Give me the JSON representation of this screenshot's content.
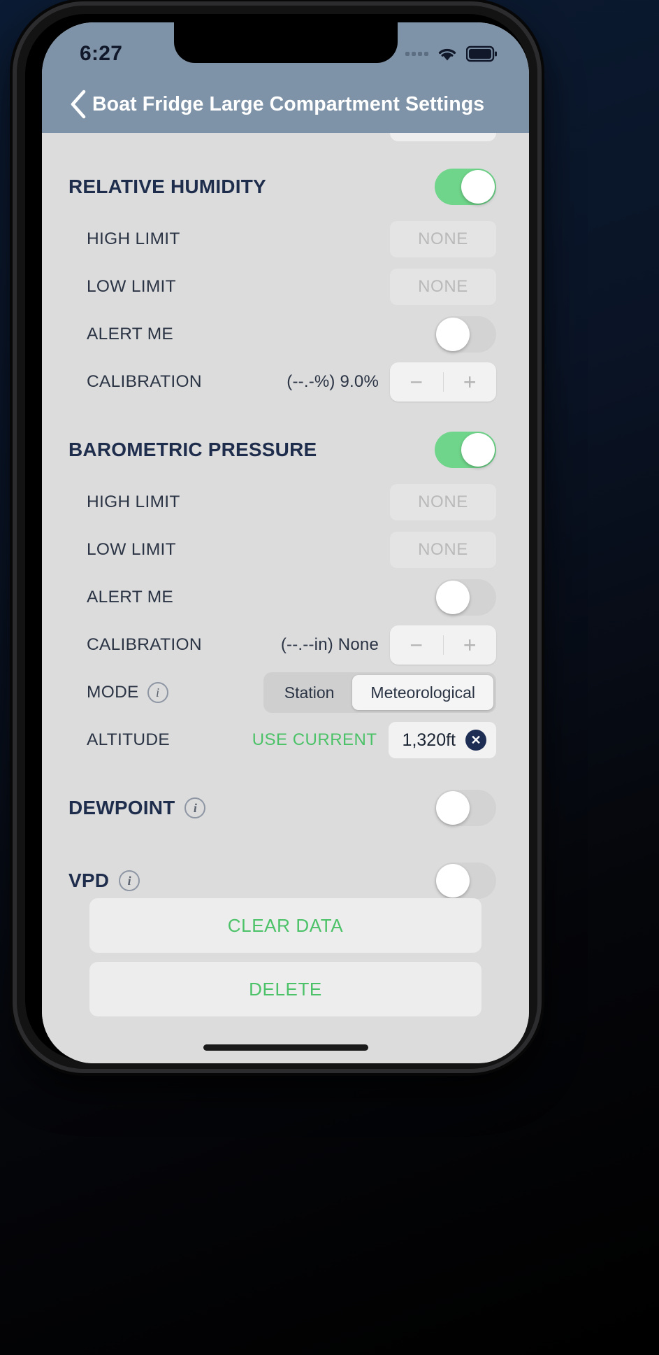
{
  "status_bar": {
    "time": "6:27",
    "signal_icon": "signal-dots-icon",
    "wifi_icon": "wifi-icon",
    "battery_icon": "battery-full-icon"
  },
  "nav": {
    "back_icon": "chevron-left-icon",
    "title": "Boat Fridge Large Compartment Settings"
  },
  "sections": {
    "relative_humidity": {
      "title": "RELATIVE HUMIDITY",
      "enabled": true,
      "rows": {
        "high_limit": {
          "label": "HIGH LIMIT",
          "value": "NONE"
        },
        "low_limit": {
          "label": "LOW LIMIT",
          "value": "NONE"
        },
        "alert_me": {
          "label": "ALERT ME",
          "enabled": false
        },
        "calibration": {
          "label": "CALIBRATION",
          "readout": "(--.-%) 9.0%",
          "minus": "−",
          "plus": "+"
        }
      }
    },
    "barometric_pressure": {
      "title": "BAROMETRIC PRESSURE",
      "enabled": true,
      "rows": {
        "high_limit": {
          "label": "HIGH LIMIT",
          "value": "NONE"
        },
        "low_limit": {
          "label": "LOW LIMIT",
          "value": "NONE"
        },
        "alert_me": {
          "label": "ALERT ME",
          "enabled": false
        },
        "calibration": {
          "label": "CALIBRATION",
          "readout": "(--.--in) None",
          "minus": "−",
          "plus": "+"
        },
        "mode": {
          "label": "MODE",
          "info_icon": "info-icon",
          "options": [
            "Station",
            "Meteorological"
          ],
          "selected": "Meteorological"
        },
        "altitude": {
          "label": "ALTITUDE",
          "use_current_label": "USE CURRENT",
          "value": "1,320ft",
          "clear_icon": "clear-circle-icon",
          "clear_glyph": "✕"
        }
      }
    },
    "dewpoint": {
      "title": "DEWPOINT",
      "info_icon": "info-icon",
      "enabled": false
    },
    "vpd": {
      "title": "VPD",
      "info_icon": "info-icon",
      "enabled": false
    }
  },
  "bottom_actions": {
    "clear_data": "CLEAR DATA",
    "delete": "DELETE"
  },
  "colors": {
    "accent_green": "#4cc268",
    "toggle_on": "#6fd58a",
    "nav_bar": "#7f93a8",
    "heading_navy": "#1f2d4d",
    "clear_btn_navy": "#1d2d54"
  }
}
